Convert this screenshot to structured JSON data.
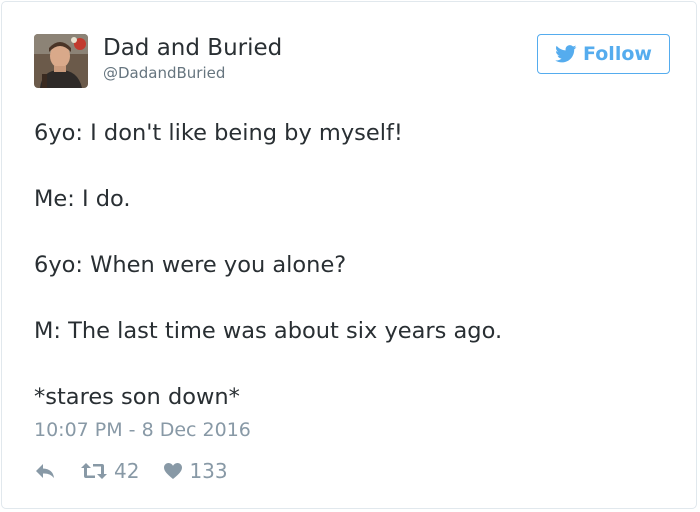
{
  "user": {
    "display_name": "Dad and Buried",
    "handle": "@DadandBuried",
    "avatar_icon": "user-photo"
  },
  "follow_button": {
    "label": "Follow",
    "icon": "twitter-bird-icon",
    "color": "#55acee"
  },
  "tweet": {
    "lines": [
      "6yo: I don't like being by myself!",
      "Me: I do.",
      "6yo: When were you alone?",
      "M: The last time was about six years ago.",
      "*stares son down*"
    ],
    "timestamp": "10:07 PM - 8 Dec 2016"
  },
  "actions": {
    "reply_icon": "reply-icon",
    "retweet_icon": "retweet-icon",
    "retweet_count": "42",
    "like_icon": "heart-icon",
    "like_count": "133"
  }
}
